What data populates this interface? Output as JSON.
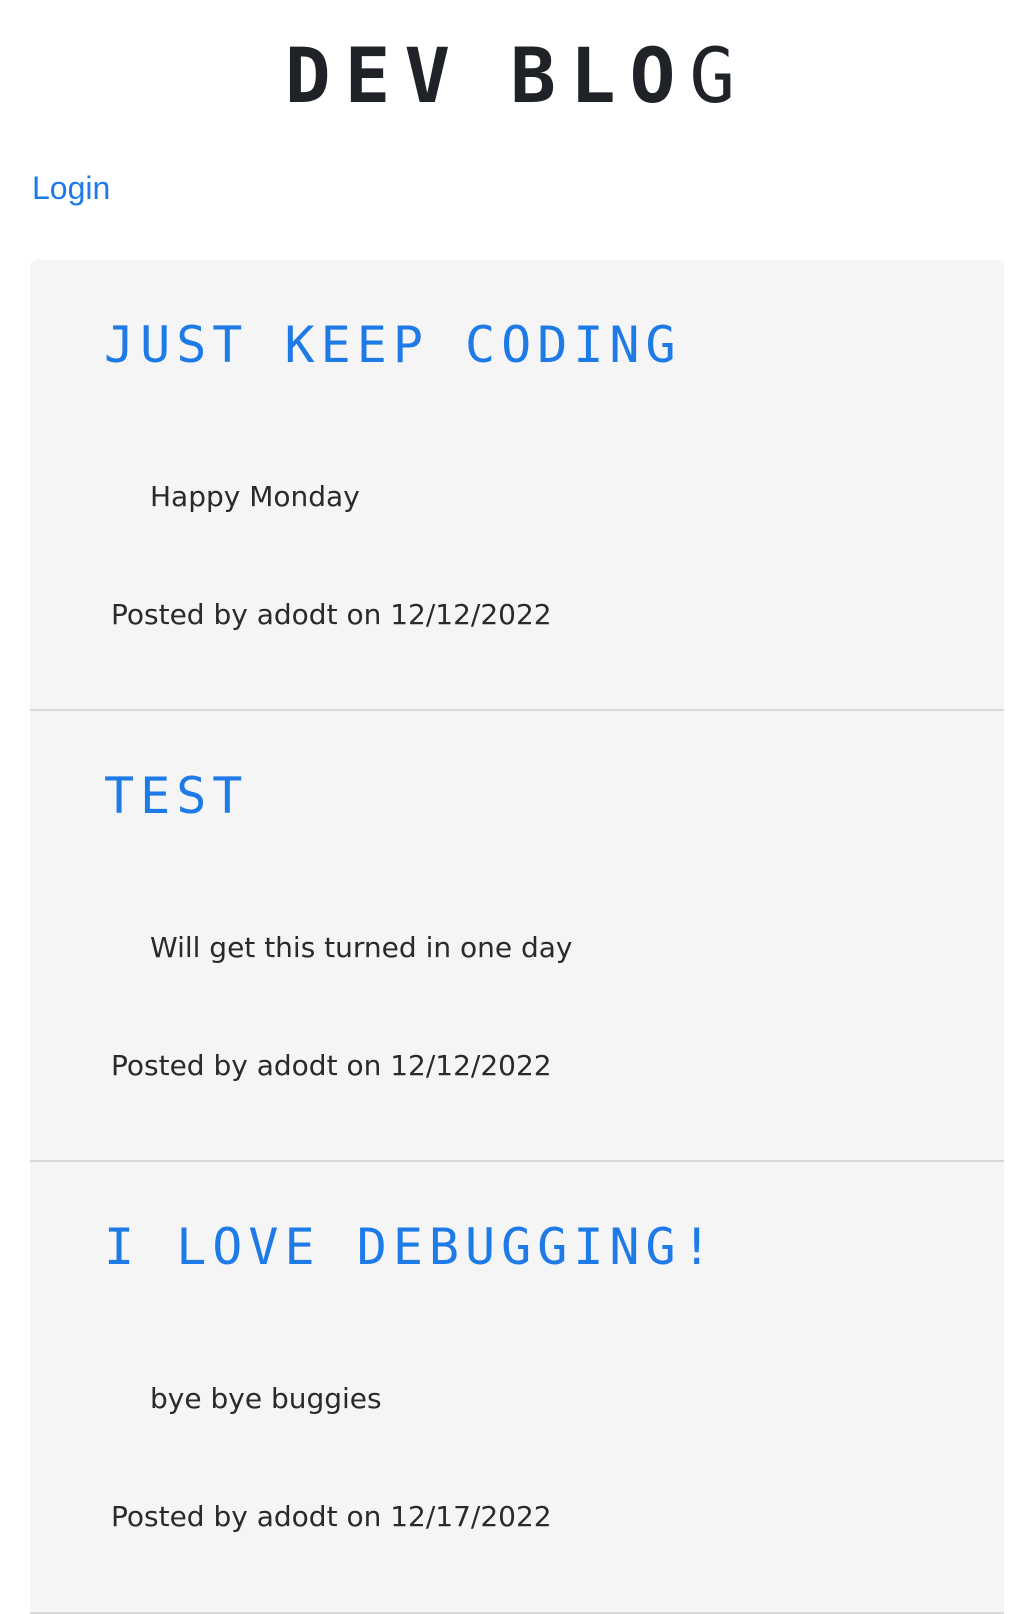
{
  "header": {
    "logo_word1": "DEV",
    "logo_word2_bold": "BLO",
    "logo_word2_thin": "G"
  },
  "nav": {
    "login_label": "Login"
  },
  "posts": [
    {
      "title": "Just Keep Coding",
      "body": "Happy Monday",
      "meta": "Posted by adodt on 12/12/2022"
    },
    {
      "title": "Test",
      "body": "Will get this turned in one day",
      "meta": "Posted by adodt on 12/12/2022"
    },
    {
      "title": "I Love Debugging!",
      "body": "bye bye buggies",
      "meta": "Posted by adodt on 12/17/2022"
    }
  ],
  "colors": {
    "accent": "#1e7ae6",
    "text": "#1f2328",
    "card_bg": "#f5f5f5",
    "divider": "#d9d9d9"
  }
}
